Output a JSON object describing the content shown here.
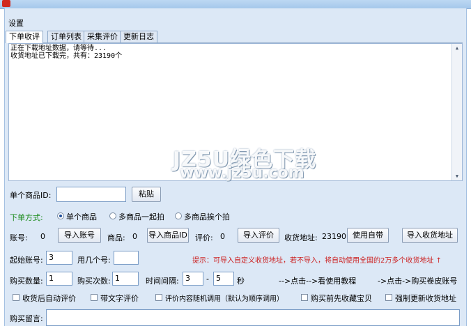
{
  "window": {
    "title": ""
  },
  "menu": {
    "settings": "设置"
  },
  "tabs": [
    "下单收评",
    "订单列表",
    "采集评价",
    "更新日志"
  ],
  "log": {
    "lines": [
      "正在下载地址数据，请等待...",
      "收货地址已下载完，共有：23190个"
    ]
  },
  "watermark": {
    "line1": "JZ5U绿色下载",
    "line2": "www.jz5u.com"
  },
  "product": {
    "id_label": "单个商品ID:",
    "id_value": "",
    "paste_label": "粘贴"
  },
  "order_mode": {
    "label": "下单方式:",
    "options": [
      "单个商品",
      "多商品一起拍",
      "多商品挨个拍"
    ],
    "selected": 0
  },
  "import_row": {
    "account_label": "账号:",
    "account_count": "0",
    "import_account": "导入账号",
    "goods_label": "商品:",
    "goods_count": "0",
    "import_goods": "导入商品ID",
    "review_label": "评价:",
    "review_count": "0",
    "import_review": "导入评价",
    "address_label": "收货地址:",
    "address_count": "23190",
    "use_builtin": "使用自带",
    "import_address": "导入收货地址"
  },
  "start_row": {
    "start_account_label": "起始账号:",
    "start_account_value": "3",
    "use_count_label": "用几个号:",
    "use_count_value": "",
    "hint": "提示：可导入自定义收货地址，若不导入，将自动使用全国的2万多个收货地址 ↑"
  },
  "buy_row": {
    "qty_label": "购买数量:",
    "qty_value": "1",
    "times_label": "购买次数:",
    "times_value": "1",
    "interval_label": "时间间隔:",
    "interval_from": "3",
    "dash": "-",
    "interval_to": "5",
    "sec": "秒",
    "tutorial_link": "-->点击-->看使用教程",
    "buy_account_link": "->点击->购买卷皮账号"
  },
  "options": [
    "收货后自动评价",
    "带文字评价",
    "评价内容随机调用（默认为顺序调用）",
    "购买前先收藏宝贝",
    "强制更新收货地址"
  ],
  "message": {
    "label": "购买留言:",
    "value": ""
  },
  "colors": {
    "accent": "#1a8a1a",
    "hint": "#cc1f1f",
    "window_bg": "#dce8f6"
  }
}
